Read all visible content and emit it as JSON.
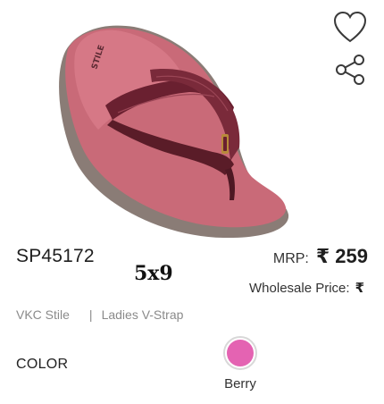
{
  "product": {
    "sku": "SP45172",
    "size_text": "5x9",
    "brand": "VKC Stile",
    "separator": "|",
    "category": "Ladies V-Strap",
    "insole_brand_mark": "STILE"
  },
  "pricing": {
    "mrp_label": "MRP:",
    "mrp_value": "₹ 259",
    "wholesale_label": "Wholesale Price:",
    "wholesale_value": "₹"
  },
  "color_section": {
    "label": "COLOR",
    "options": [
      {
        "name": "Berry",
        "hex": "#e463b2"
      }
    ]
  },
  "icons": {
    "wishlist": "heart-icon",
    "share": "share-icon"
  },
  "colors": {
    "sole_pink": "#c96a78",
    "strap_maroon": "#6a2030",
    "sole_base": "#8a7c76"
  }
}
